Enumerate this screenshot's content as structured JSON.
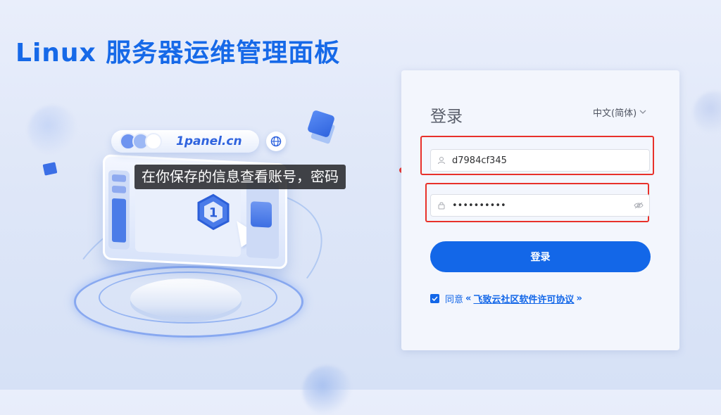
{
  "page": {
    "title": "Linux 服务器运维管理面板"
  },
  "illustration": {
    "url_text": "1panel.cn"
  },
  "tooltip": {
    "text": "在你保存的信息查看账号，密码"
  },
  "login": {
    "title": "登录",
    "language": "中文(简体)",
    "username_value": "d7984cf345",
    "password_value": "••••••••••",
    "submit_label": "登录",
    "agree_prefix": "同意",
    "agree_open_quote": "«",
    "agree_link": "飞致云社区软件许可协议",
    "agree_close_quote": "»",
    "agree_checked": true
  },
  "colors": {
    "brand": "#1367e8",
    "highlight": "#e8312a",
    "background": "#e4ebf9"
  },
  "icons": {
    "user": "user-icon",
    "lock": "lock-icon",
    "eye": "eye-off-icon",
    "globe": "globe-icon",
    "chevron": "chevron-down-icon",
    "check": "check-icon"
  }
}
